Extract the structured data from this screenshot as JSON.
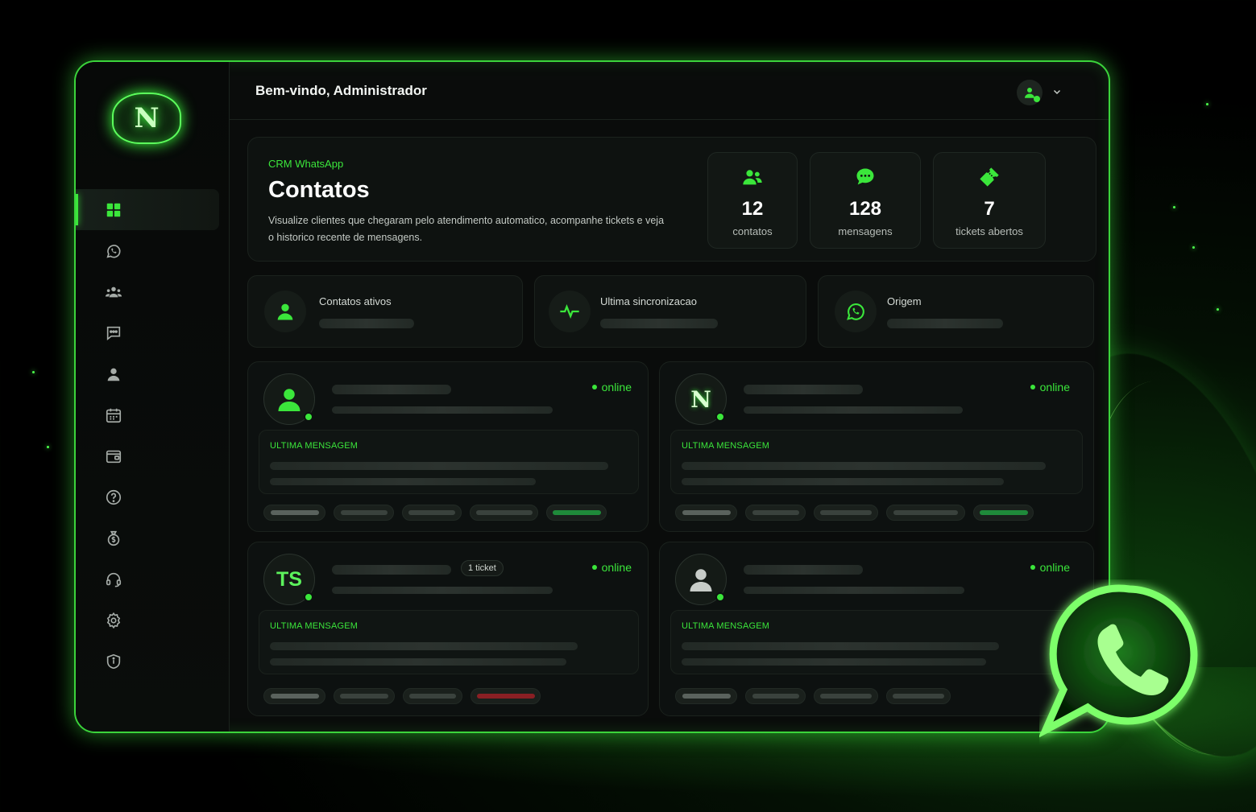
{
  "colors": {
    "accent": "#3be63b",
    "background": "#000000",
    "panel": "#0e1210",
    "danger": "#8a1f24"
  },
  "header": {
    "welcome": "Bem-vindo, Administrador"
  },
  "sidebar": {
    "logo_letter": "N",
    "items": [
      {
        "icon": "grid-icon",
        "active": true
      },
      {
        "icon": "whatsapp-icon"
      },
      {
        "icon": "users-icon"
      },
      {
        "icon": "chat-icon"
      },
      {
        "icon": "user-icon"
      },
      {
        "icon": "calendar-icon"
      },
      {
        "icon": "wallet-icon"
      },
      {
        "icon": "help-icon"
      },
      {
        "icon": "money-bag-icon"
      },
      {
        "icon": "headset-icon"
      },
      {
        "icon": "settings-icon"
      },
      {
        "icon": "shield-icon"
      }
    ]
  },
  "hero": {
    "eyebrow": "CRM WhatsApp",
    "title": "Contatos",
    "description": "Visualize clientes que chegaram pelo atendimento automatico, acompanhe tickets e veja o historico recente de mensagens."
  },
  "stats": [
    {
      "value": "12",
      "label": "contatos",
      "icon": "users-icon"
    },
    {
      "value": "128",
      "label": "mensagens",
      "icon": "chat-bubble-icon"
    },
    {
      "value": "7",
      "label": "tickets abertos",
      "icon": "ticket-icon"
    }
  ],
  "info_cards": [
    {
      "label": "Contatos ativos",
      "icon": "user-icon"
    },
    {
      "label": "Ultima sincronizacao",
      "icon": "pulse-icon"
    },
    {
      "label": "Origem",
      "icon": "whatsapp-icon"
    }
  ],
  "contacts": [
    {
      "avatar": "user-icon",
      "status": "online",
      "message_header": "ULTIMA MENSAGEM"
    },
    {
      "avatar": "N",
      "status": "online",
      "message_header": "ULTIMA MENSAGEM"
    },
    {
      "avatar": "TS",
      "status": "online",
      "badge": "1 ticket",
      "message_header": "ULTIMA MENSAGEM"
    },
    {
      "avatar": "user-gray-icon",
      "status": "online",
      "message_header": "ULTIMA MENSAGEM"
    }
  ]
}
